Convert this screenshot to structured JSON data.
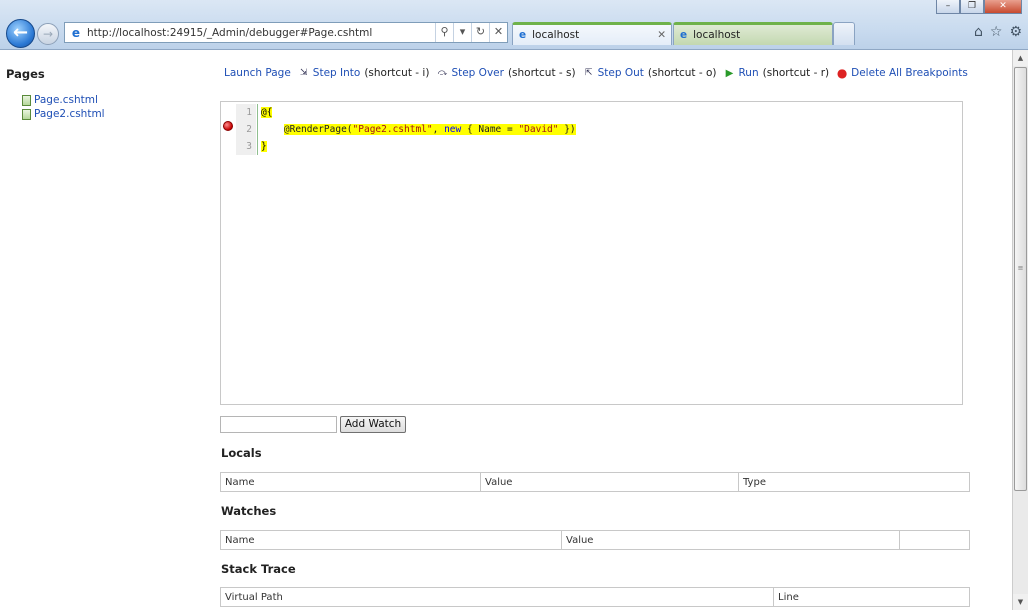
{
  "browser": {
    "address_url": "http://localhost:24915/_Admin/debugger#Page.cshtml",
    "tabs": [
      {
        "label": "localhost"
      },
      {
        "label": "localhost"
      }
    ]
  },
  "sidebar": {
    "title": "Pages",
    "items": [
      {
        "label": "Page.cshtml"
      },
      {
        "label": "Page2.cshtml"
      }
    ]
  },
  "toolbar": {
    "launch_page": "Launch Page",
    "step_into": "Step Into",
    "step_into_hint": "(shortcut - i)",
    "step_over": "Step Over",
    "step_over_hint": "(shortcut - s)",
    "step_out": "Step Out",
    "step_out_hint": "(shortcut - o)",
    "run": "Run",
    "run_hint": "(shortcut - r)",
    "delete_breakpoints": "Delete All Breakpoints"
  },
  "editor": {
    "line_numbers": [
      "1",
      "2",
      "3"
    ],
    "breakpoint_line": 2,
    "highlight_color": "#ffff00",
    "lines": {
      "l1": "@{",
      "l2_indent": "    ",
      "l2_call": "@RenderPage(",
      "l2_str": "\"Page2.cshtml\"",
      "l2_mid": ", ",
      "l2_kw": "new",
      "l2_obj": " { Name = ",
      "l2_val": "\"David\"",
      "l2_end": " })",
      "l3": "}"
    }
  },
  "watch": {
    "input_value": "",
    "add_button": "Add Watch"
  },
  "locals": {
    "title": "Locals",
    "columns": [
      "Name",
      "Value",
      "Type"
    ]
  },
  "watches": {
    "title": "Watches",
    "columns": [
      "Name",
      "Value",
      ""
    ]
  },
  "stack_trace": {
    "title": "Stack Trace",
    "columns": [
      "Virtual Path",
      "Line"
    ]
  }
}
